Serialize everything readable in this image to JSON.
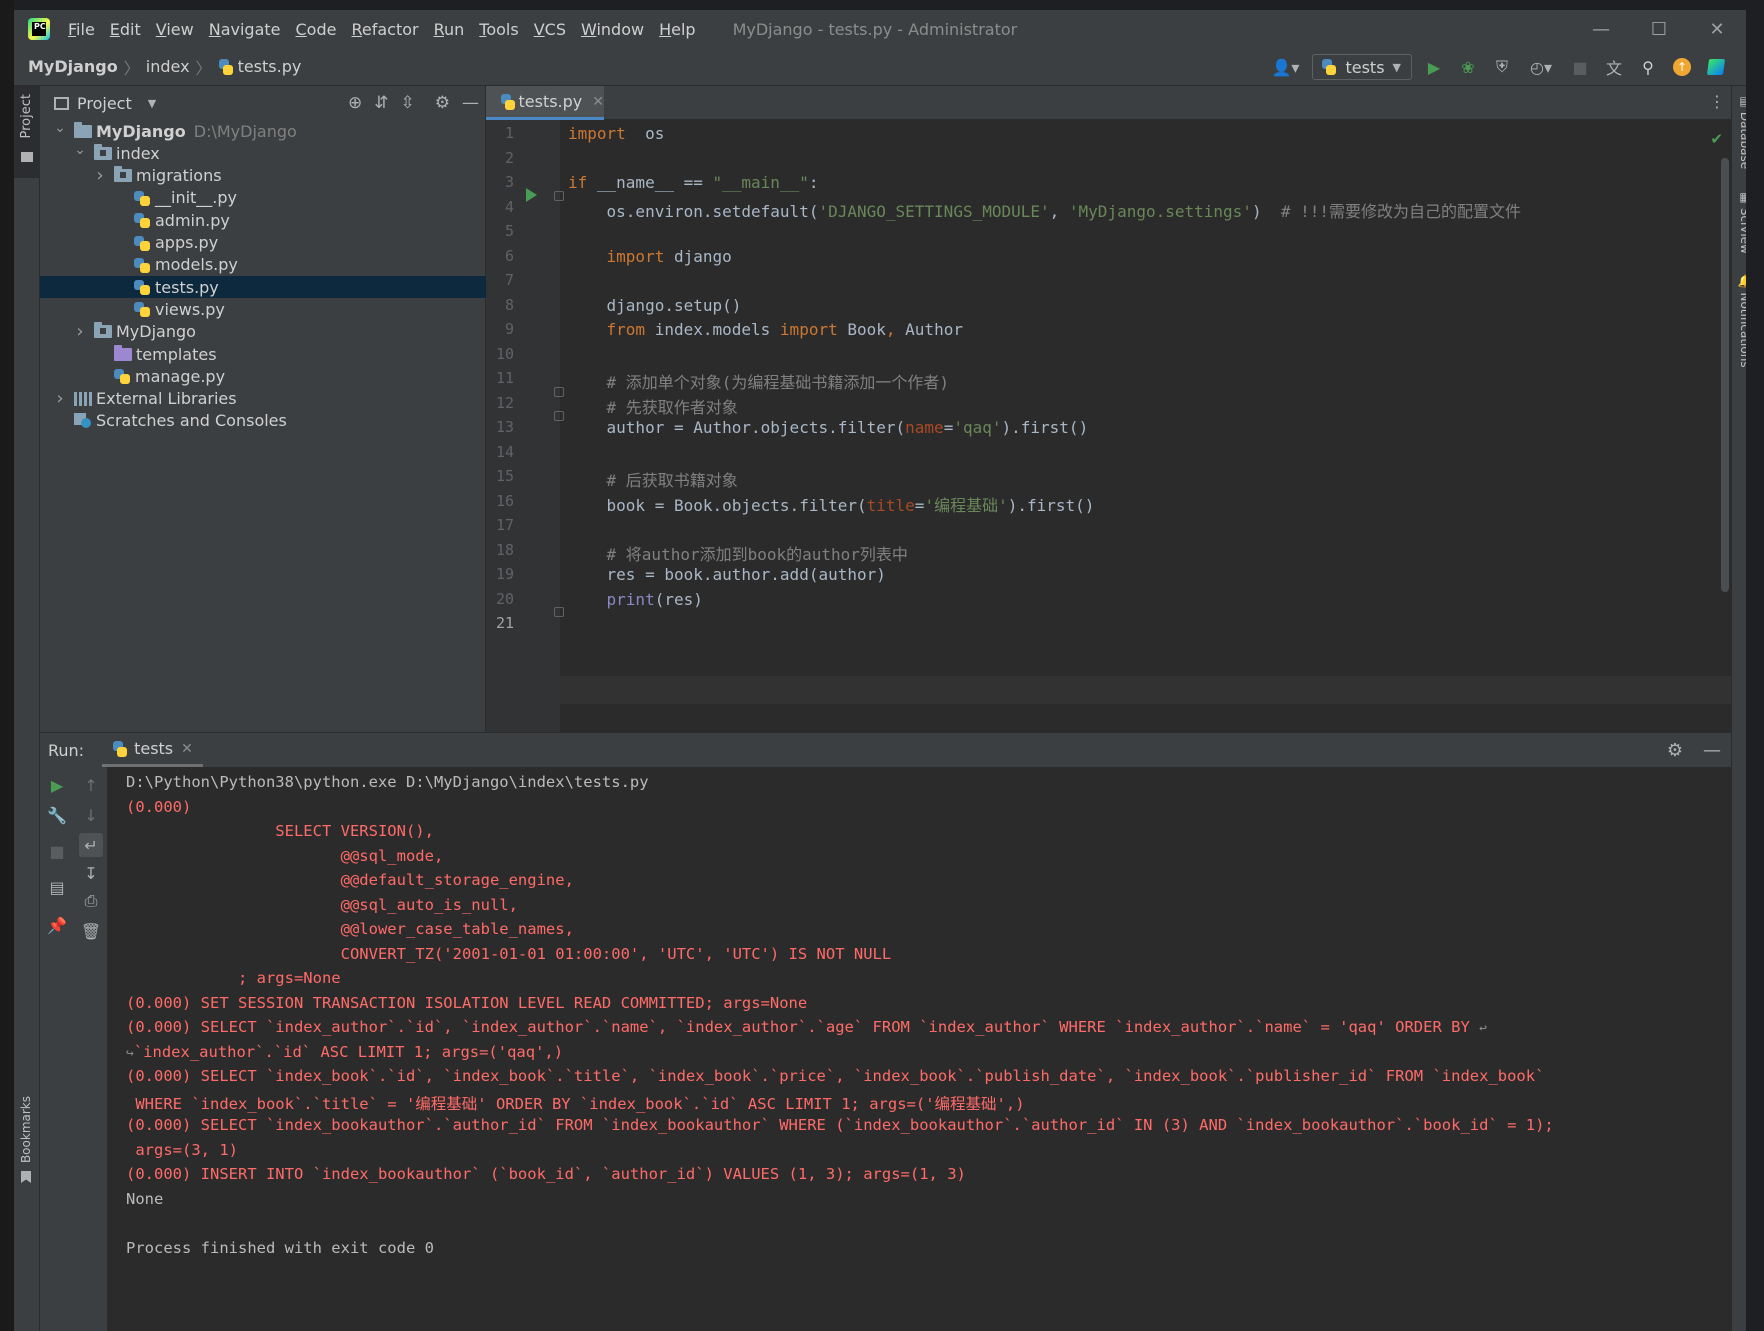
{
  "window": {
    "title": "MyDjango - tests.py - Administrator",
    "menu": [
      "File",
      "Edit",
      "View",
      "Navigate",
      "Code",
      "Refactor",
      "Run",
      "Tools",
      "VCS",
      "Window",
      "Help"
    ],
    "controls": {
      "minimize": "—",
      "maximize": "☐",
      "close": "✕"
    }
  },
  "navbar": {
    "breadcrumb": [
      "MyDjango",
      "index",
      "tests.py"
    ],
    "run_config": "tests"
  },
  "left_stripe": {
    "project": "Project",
    "bookmarks": "Bookmarks"
  },
  "right_stripe": {
    "database": "Database",
    "sciview": "SciView",
    "notifications": "Notifications"
  },
  "project_panel": {
    "title": "Project",
    "tree": [
      {
        "label": "MyDjango",
        "hint": "D:\\MyDjango",
        "kind": "folder",
        "level": 0,
        "expanded": true
      },
      {
        "label": "index",
        "kind": "module",
        "level": 1,
        "expanded": true
      },
      {
        "label": "migrations",
        "kind": "module",
        "level": 2,
        "expanded": false
      },
      {
        "label": "__init__.py",
        "kind": "py",
        "level": 3
      },
      {
        "label": "admin.py",
        "kind": "py",
        "level": 3
      },
      {
        "label": "apps.py",
        "kind": "py",
        "level": 3
      },
      {
        "label": "models.py",
        "kind": "py",
        "level": 3
      },
      {
        "label": "tests.py",
        "kind": "py",
        "level": 3,
        "selected": true
      },
      {
        "label": "views.py",
        "kind": "py",
        "level": 3
      },
      {
        "label": "MyDjango",
        "kind": "module",
        "level": 1,
        "expanded": false
      },
      {
        "label": "templates",
        "kind": "templates",
        "level": 2
      },
      {
        "label": "manage.py",
        "kind": "py",
        "level": 2
      },
      {
        "label": "External Libraries",
        "kind": "lib",
        "level": 0,
        "expanded": false
      },
      {
        "label": "Scratches and Consoles",
        "kind": "scratch",
        "level": 0
      }
    ]
  },
  "editor": {
    "tab": "tests.py",
    "current_line": 21,
    "lines": [
      {
        "n": 1,
        "tokens": [
          [
            "kw",
            "import"
          ],
          [
            "",
            "  os"
          ]
        ]
      },
      {
        "n": 2,
        "tokens": []
      },
      {
        "n": 3,
        "tokens": [
          [
            "kw",
            "if"
          ],
          [
            "",
            " __name__ == "
          ],
          [
            "str",
            "\"__main__\""
          ],
          [
            "",
            ":"
          ]
        ]
      },
      {
        "n": 4,
        "tokens": [
          [
            "",
            "    os.environ.setdefault("
          ],
          [
            "str",
            "'DJANGO_SETTINGS_MODULE'"
          ],
          [
            "",
            ", "
          ],
          [
            "str",
            "'MyDjango.settings'"
          ],
          [
            "",
            ")  "
          ],
          [
            "cm",
            "# !!!需要修改为自己的配置文件"
          ]
        ]
      },
      {
        "n": 5,
        "tokens": []
      },
      {
        "n": 6,
        "tokens": [
          [
            "",
            "    "
          ],
          [
            "kw",
            "import"
          ],
          [
            "",
            " django"
          ]
        ]
      },
      {
        "n": 7,
        "tokens": []
      },
      {
        "n": 8,
        "tokens": [
          [
            "",
            "    django.setup()"
          ]
        ]
      },
      {
        "n": 9,
        "tokens": [
          [
            "",
            "    "
          ],
          [
            "kw",
            "from"
          ],
          [
            "",
            " index.models "
          ],
          [
            "kw",
            "import"
          ],
          [
            "",
            " Book"
          ],
          [
            "kw",
            ","
          ],
          [
            "",
            " Author"
          ]
        ]
      },
      {
        "n": 10,
        "tokens": []
      },
      {
        "n": 11,
        "tokens": [
          [
            "",
            "    "
          ],
          [
            "cm",
            "# 添加单个对象(为编程基础书籍添加一个作者)"
          ]
        ]
      },
      {
        "n": 12,
        "tokens": [
          [
            "",
            "    "
          ],
          [
            "cm",
            "# 先获取作者对象"
          ]
        ]
      },
      {
        "n": 13,
        "tokens": [
          [
            "",
            "    author = Author.objects.filter("
          ],
          [
            "param",
            "name"
          ],
          [
            "",
            "="
          ],
          [
            "str",
            "'qaq'"
          ],
          [
            "",
            ").first()"
          ]
        ]
      },
      {
        "n": 14,
        "tokens": []
      },
      {
        "n": 15,
        "tokens": [
          [
            "",
            "    "
          ],
          [
            "cm",
            "# 后获取书籍对象"
          ]
        ]
      },
      {
        "n": 16,
        "tokens": [
          [
            "",
            "    book = Book.objects.filter("
          ],
          [
            "param",
            "title"
          ],
          [
            "",
            "="
          ],
          [
            "str",
            "'编程基础'"
          ],
          [
            "",
            ").first()"
          ]
        ]
      },
      {
        "n": 17,
        "tokens": []
      },
      {
        "n": 18,
        "tokens": [
          [
            "",
            "    "
          ],
          [
            "cm",
            "# 将author添加到book的author列表中"
          ]
        ]
      },
      {
        "n": 19,
        "tokens": [
          [
            "",
            "    res = book.author.add(author)"
          ]
        ]
      },
      {
        "n": 20,
        "tokens": [
          [
            "",
            "    "
          ],
          [
            "bi",
            "print"
          ],
          [
            "",
            "(res)"
          ]
        ]
      },
      {
        "n": 21,
        "tokens": []
      }
    ]
  },
  "run_panel": {
    "label": "Run:",
    "tab": "tests",
    "console": [
      {
        "t": "D:\\Python\\Python38\\python.exe D:\\MyDjango\\index\\tests.py",
        "err": false
      },
      {
        "t": "(0.000)",
        "err": true
      },
      {
        "t": "                SELECT VERSION(),",
        "err": true
      },
      {
        "t": "                       @@sql_mode,",
        "err": true
      },
      {
        "t": "                       @@default_storage_engine,",
        "err": true
      },
      {
        "t": "                       @@sql_auto_is_null,",
        "err": true
      },
      {
        "t": "                       @@lower_case_table_names,",
        "err": true
      },
      {
        "t": "                       CONVERT_TZ('2001-01-01 01:00:00', 'UTC', 'UTC') IS NOT NULL",
        "err": true
      },
      {
        "t": "            ; args=None",
        "err": true
      },
      {
        "t": "(0.000) SET SESSION TRANSACTION ISOLATION LEVEL READ COMMITTED; args=None",
        "err": true
      },
      {
        "t": "(0.000) SELECT `index_author`.`id`, `index_author`.`name`, `index_author`.`age` FROM `index_author` WHERE `index_author`.`name` = 'qaq' ORDER BY ",
        "err": true,
        "wrap_end": "↩"
      },
      {
        "t": "`index_author`.`id` ASC LIMIT 1; args=('qaq',)",
        "err": true,
        "wrap_start": "↪"
      },
      {
        "t": "(0.000) SELECT `index_book`.`id`, `index_book`.`title`, `index_book`.`price`, `index_book`.`publish_date`, `index_book`.`publisher_id` FROM `index_book`",
        "err": true
      },
      {
        "t": " WHERE `index_book`.`title` = '编程基础' ORDER BY `index_book`.`id` ASC LIMIT 1; args=('编程基础',)",
        "err": true
      },
      {
        "t": "(0.000) SELECT `index_bookauthor`.`author_id` FROM `index_bookauthor` WHERE (`index_bookauthor`.`author_id` IN (3) AND `index_bookauthor`.`book_id` = 1);",
        "err": true
      },
      {
        "t": " args=(3, 1)",
        "err": true
      },
      {
        "t": "(0.000) INSERT INTO `index_bookauthor` (`book_id`, `author_id`) VALUES (1, 3); args=(1, 3)",
        "err": true
      },
      {
        "t": "None",
        "err": false
      },
      {
        "t": "",
        "err": false
      },
      {
        "t": "Process finished with exit code 0",
        "err": false
      }
    ]
  },
  "colors": {
    "keyword": "#cc7832",
    "string": "#6a8759",
    "comment": "#808080",
    "param": "#aa4926",
    "error_output": "#ff6b68",
    "run_green": "#499c54",
    "selection": "#0d293e"
  }
}
